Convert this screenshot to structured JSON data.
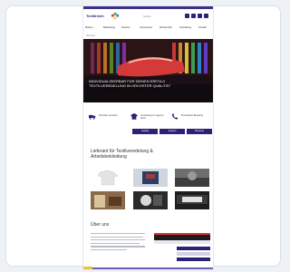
{
  "header": {
    "logo_text": "Textilreich",
    "search_label": "Suche",
    "icons": [
      "user-icon",
      "heart-icon",
      "cart-icon",
      "menu-icon"
    ]
  },
  "nav": {
    "items": [
      "Marken",
      "Bekleidung",
      "Taschen",
      "Accessoires",
      "Werbemittel",
      "Veredelung",
      "Kontakt"
    ]
  },
  "breadcrumb": "Startseite",
  "hero": {
    "caption_line1": "INDIVIDUALISIERBAR FÜR DEINEN ERFOLG",
    "caption_line2": "TEXTILVEREDELUNG IN HÖCHSTER QUALITÄT"
  },
  "services": [
    {
      "icon": "truck-icon",
      "text": "Schneller Versand"
    },
    {
      "icon": "shirt-icon",
      "text": "Veredelung im eigenen Haus"
    },
    {
      "icon": "phone-icon",
      "text": "Persönliche Beratung"
    }
  ],
  "tabs": [
    "Katalog",
    "Angebot",
    "Beratung"
  ],
  "section": {
    "title": "Lieferant für Textilveredelung & Arbeitsbekleidung"
  },
  "gallery": {
    "items": [
      "gallery-image-1",
      "gallery-image-2",
      "gallery-image-3",
      "gallery-image-4",
      "gallery-image-5",
      "gallery-image-6"
    ]
  },
  "about": {
    "title": "Über uns"
  },
  "colors": {
    "primary": "#2a2277",
    "topbar": "#3b2f87",
    "accent_yellow": "#e7c23a",
    "background": "#eef1f5"
  }
}
